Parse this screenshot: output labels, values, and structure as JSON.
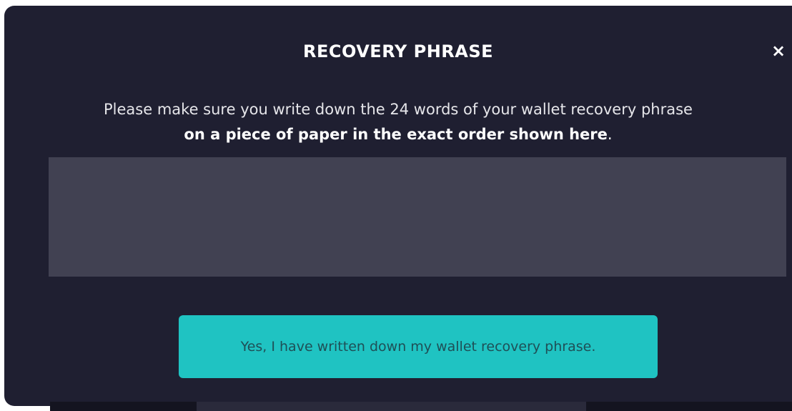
{
  "modal": {
    "title": "RECOVERY PHRASE",
    "close_icon": "×",
    "instructions": {
      "line1": "Please make sure you write down the 24 words of your wallet recovery phrase",
      "line2_bold": "on a piece of paper in the exact order shown here",
      "line2_end": "."
    },
    "phrase_words": [],
    "confirm_button_label": "Yes, I have written down my wallet recovery phrase."
  },
  "colors": {
    "modal_background": "#1f1f31",
    "phrase_box": "#414152",
    "accent": "#1fc3c2",
    "button_text": "#1f4f56"
  }
}
